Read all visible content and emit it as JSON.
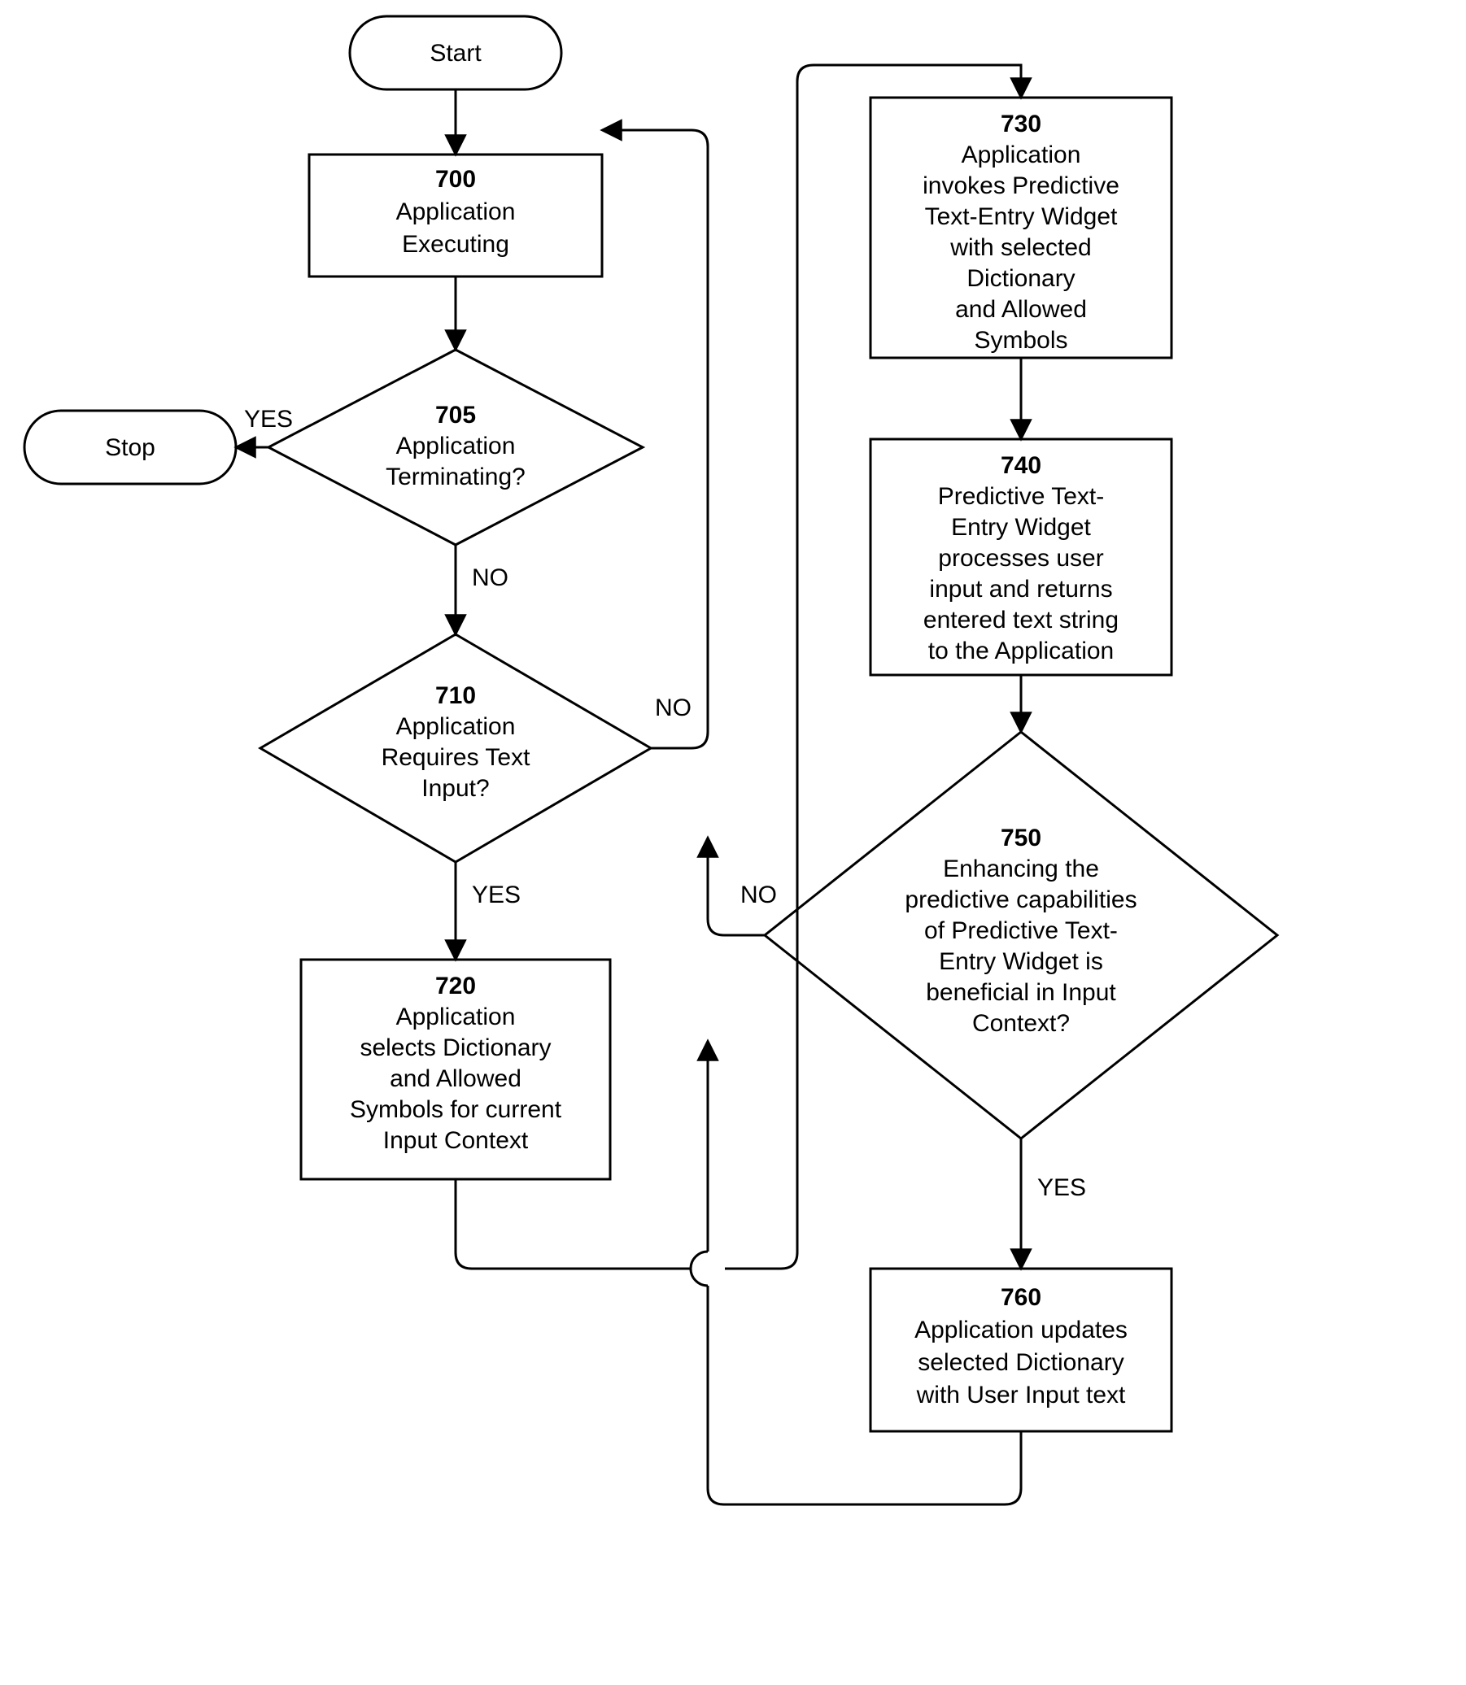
{
  "chart_data": {
    "type": "flowchart",
    "nodes": [
      {
        "id": "start",
        "shape": "terminator",
        "label": "Start"
      },
      {
        "id": "700",
        "shape": "process",
        "num": "700",
        "label": "Application Executing"
      },
      {
        "id": "705",
        "shape": "decision",
        "num": "705",
        "label": "Application Terminating?"
      },
      {
        "id": "stop",
        "shape": "terminator",
        "label": "Stop"
      },
      {
        "id": "710",
        "shape": "decision",
        "num": "710",
        "label": "Application Requires Text Input?"
      },
      {
        "id": "720",
        "shape": "process",
        "num": "720",
        "label": "Application selects Dictionary and Allowed Symbols for current Input Context"
      },
      {
        "id": "730",
        "shape": "process",
        "num": "730",
        "label": "Application invokes Predictive Text-Entry Widget with selected Dictionary and Allowed Symbols"
      },
      {
        "id": "740",
        "shape": "process",
        "num": "740",
        "label": "Predictive Text-Entry Widget processes user input and returns entered text string to the Application"
      },
      {
        "id": "750",
        "shape": "decision",
        "num": "750",
        "label": "Enhancing the predictive capabilities of Predictive Text-Entry Widget is beneficial in Input Context?"
      },
      {
        "id": "760",
        "shape": "process",
        "num": "760",
        "label": "Application updates selected Dictionary with User Input text"
      }
    ],
    "edges": [
      {
        "from": "start",
        "to": "700"
      },
      {
        "from": "700",
        "to": "705"
      },
      {
        "from": "705",
        "to": "stop",
        "label": "YES"
      },
      {
        "from": "705",
        "to": "710",
        "label": "NO"
      },
      {
        "from": "710",
        "to": "700",
        "label": "NO"
      },
      {
        "from": "710",
        "to": "720",
        "label": "YES"
      },
      {
        "from": "720",
        "to": "730"
      },
      {
        "from": "730",
        "to": "740"
      },
      {
        "from": "740",
        "to": "750"
      },
      {
        "from": "750",
        "to": "700",
        "label": "NO"
      },
      {
        "from": "750",
        "to": "760",
        "label": "YES"
      },
      {
        "from": "760",
        "to": "700"
      }
    ]
  },
  "labels": {
    "start": "Start",
    "stop": "Stop",
    "yes": "YES",
    "no": "NO",
    "n700_num": "700",
    "n700_l1": "Application",
    "n700_l2": "Executing",
    "n705_num": "705",
    "n705_l1": "Application",
    "n705_l2": "Terminating?",
    "n710_num": "710",
    "n710_l1": "Application",
    "n710_l2": "Requires Text",
    "n710_l3": "Input?",
    "n720_num": "720",
    "n720_l1": "Application",
    "n720_l2": "selects Dictionary",
    "n720_l3": "and Allowed",
    "n720_l4": "Symbols for current",
    "n720_l5": "Input Context",
    "n730_num": "730",
    "n730_l1": "Application",
    "n730_l2": "invokes Predictive",
    "n730_l3": "Text-Entry Widget",
    "n730_l4": "with selected",
    "n730_l5": "Dictionary",
    "n730_l6": "and Allowed",
    "n730_l7": "Symbols",
    "n740_num": "740",
    "n740_l1": "Predictive Text-",
    "n740_l2": "Entry Widget",
    "n740_l3": "processes user",
    "n740_l4": "input and returns",
    "n740_l5": "entered text string",
    "n740_l6": "to the Application",
    "n750_num": "750",
    "n750_l1": "Enhancing the",
    "n750_l2": "predictive capabilities",
    "n750_l3": "of Predictive Text-",
    "n750_l4": "Entry Widget is",
    "n750_l5": "beneficial in Input",
    "n750_l6": "Context?",
    "n760_num": "760",
    "n760_l1": "Application updates",
    "n760_l2": "selected Dictionary",
    "n760_l3": "with User Input text"
  }
}
